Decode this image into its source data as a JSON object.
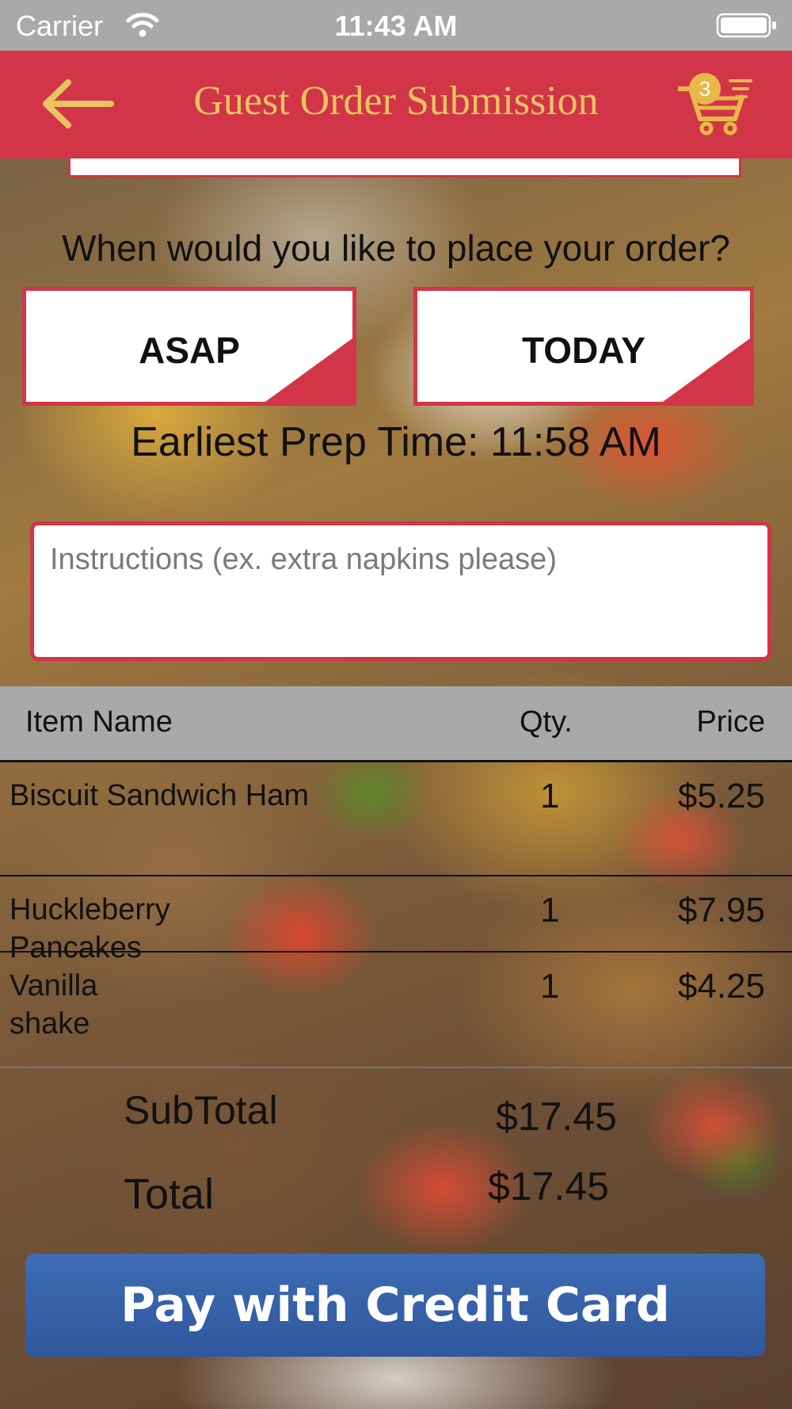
{
  "status_bar": {
    "carrier": "Carrier",
    "time": "11:43 AM"
  },
  "nav": {
    "title": "Guest Order Submission",
    "cart_count": "3"
  },
  "order_time": {
    "question": "When would you like to place your order?",
    "options": [
      "ASAP",
      "TODAY"
    ],
    "prep_time": "Earliest Prep Time: 11:58 AM"
  },
  "instructions": {
    "placeholder": "Instructions (ex. extra napkins please)",
    "value": ""
  },
  "table": {
    "headers": {
      "name": "Item Name",
      "qty": "Qty.",
      "price": "Price"
    },
    "rows": [
      {
        "name": "Biscuit Sandwich Ham",
        "qty": "1",
        "price": "$5.25"
      },
      {
        "name": "Huckleberry Pancakes",
        "qty": "1",
        "price": "$7.95"
      },
      {
        "name": "Vanilla shake",
        "qty": "1",
        "price": "$4.25"
      }
    ]
  },
  "totals": {
    "subtotal_label": "SubTotal",
    "subtotal_value": "$17.45",
    "total_label": "Total",
    "total_value": "$17.45"
  },
  "pay_button": {
    "label": "Pay with Credit Card"
  },
  "colors": {
    "brand_red": "#d23547",
    "title_gold": "#e8c460",
    "pay_blue": "#3a64ad",
    "status_gray": "#a9a9a9"
  },
  "icons": [
    "wifi-icon",
    "battery-icon",
    "back-arrow-icon",
    "cart-icon"
  ]
}
